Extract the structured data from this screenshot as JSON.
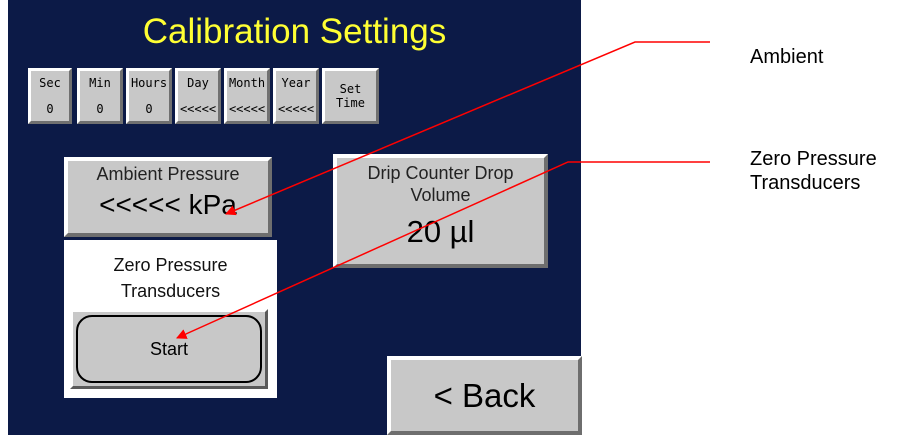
{
  "screen": {
    "title": "Calibration Settings",
    "time_buttons": [
      {
        "label": "Sec",
        "value": "0"
      },
      {
        "label": "Min",
        "value": "0"
      },
      {
        "label": "Hours",
        "value": "0"
      },
      {
        "label": "Day",
        "value": "<<<<<"
      },
      {
        "label": "Month",
        "value": "<<<<<"
      },
      {
        "label": "Year",
        "value": "<<<<<"
      }
    ],
    "set_time_label": "Set Time",
    "ambient": {
      "label": "Ambient Pressure",
      "value": "<<<<< kPa"
    },
    "drip": {
      "label_line1": "Drip Counter Drop",
      "label_line2": "Volume",
      "value": "20 µl"
    },
    "zero": {
      "label_line1": "Zero Pressure",
      "label_line2": "Transducers",
      "start_label": "Start"
    },
    "back_label": "< Back"
  },
  "callouts": {
    "ambient": "Ambient",
    "zero_line1": "Zero Pressure",
    "zero_line2": "Transducers"
  },
  "colors": {
    "screen_bg": "#0c1a47",
    "title": "#ffff33",
    "button_face": "#c8c8c8",
    "arrow": "#ff0000"
  }
}
